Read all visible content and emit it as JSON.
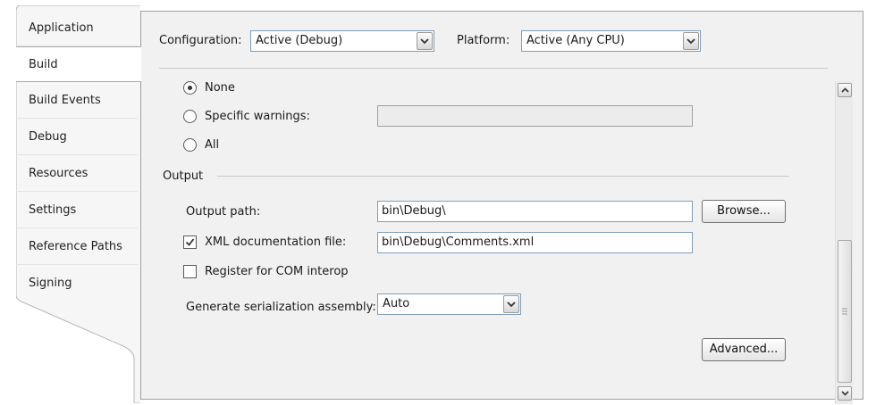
{
  "tabs": [
    {
      "label": "Application",
      "active": false
    },
    {
      "label": "Build",
      "active": true
    },
    {
      "label": "Build Events",
      "active": false
    },
    {
      "label": "Debug",
      "active": false
    },
    {
      "label": "Resources",
      "active": false
    },
    {
      "label": "Settings",
      "active": false
    },
    {
      "label": "Reference Paths",
      "active": false
    },
    {
      "label": "Signing",
      "active": false
    }
  ],
  "config": {
    "configuration_label": "Configuration:",
    "configuration_value": "Active (Debug)",
    "platform_label": "Platform:",
    "platform_value": "Active (Any CPU)"
  },
  "warnings": {
    "options": [
      {
        "label": "None",
        "checked": true
      },
      {
        "label": "Specific warnings:",
        "checked": false
      },
      {
        "label": "All",
        "checked": false
      }
    ],
    "specific_value": ""
  },
  "output": {
    "section_label": "Output",
    "output_path_label": "Output path:",
    "output_path_value": "bin\\Debug\\",
    "browse_label": "Browse...",
    "xml_doc_label": "XML documentation file:",
    "xml_doc_checked": true,
    "xml_doc_value": "bin\\Debug\\Comments.xml",
    "com_interop_label": "Register for COM interop",
    "com_interop_checked": false,
    "serialization_label": "Generate serialization assembly:",
    "serialization_value": "Auto",
    "advanced_label": "Advanced..."
  },
  "colors": {
    "panel_bg": "#f1f1f1",
    "border": "#a0a0a0",
    "input_border": "#7f9db9"
  }
}
